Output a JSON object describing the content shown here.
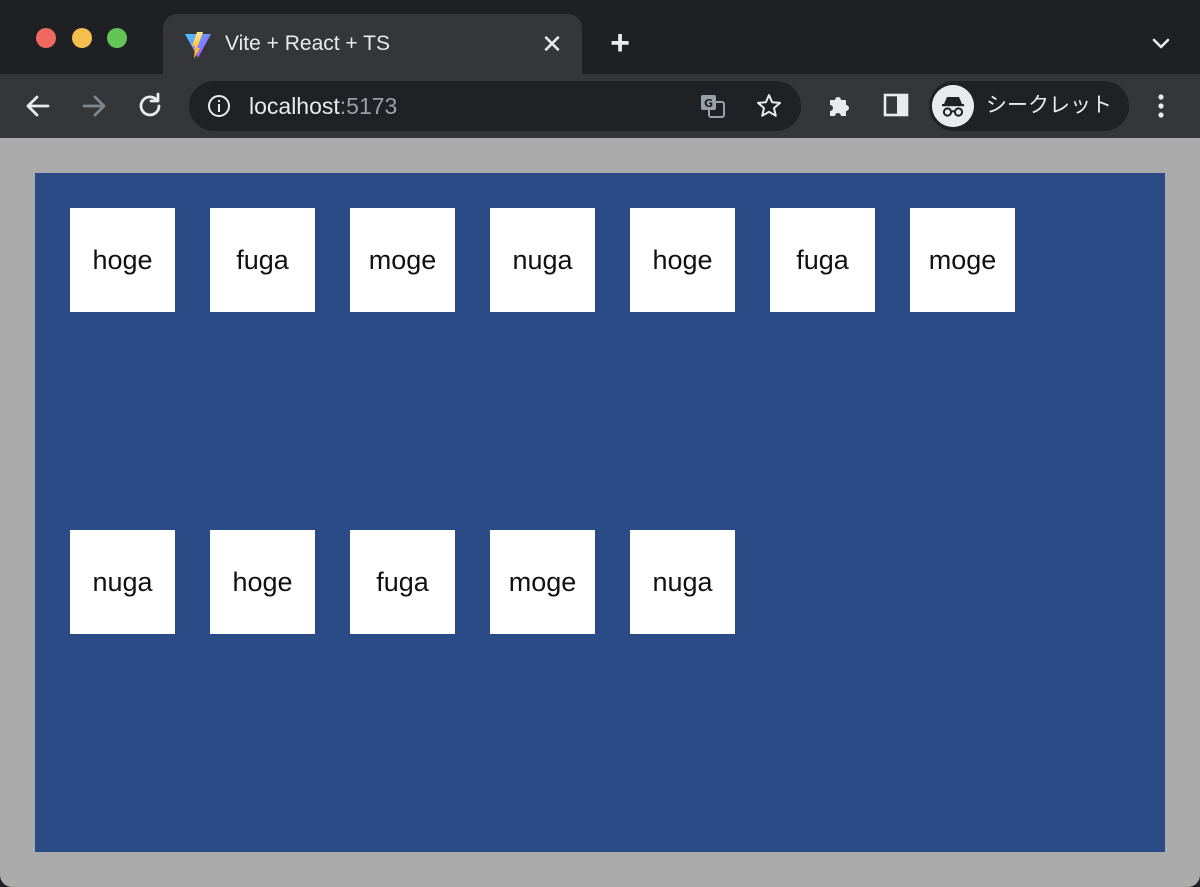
{
  "browser": {
    "tab": {
      "title": "Vite + React + TS"
    },
    "address": {
      "host": "localhost",
      "port": ":5173"
    },
    "profile": {
      "label": "シークレット"
    },
    "colors": {
      "frame": "#1f2023",
      "toolbar": "#35363a",
      "omnibox": "#202124"
    }
  },
  "page": {
    "background": "#aaaaaa",
    "container_color": "#2a4b85",
    "items": [
      {
        "label": "hoge"
      },
      {
        "label": "fuga"
      },
      {
        "label": "moge"
      },
      {
        "label": "nuga"
      },
      {
        "label": "hoge"
      },
      {
        "label": "fuga"
      },
      {
        "label": "moge"
      },
      {
        "label": "nuga"
      },
      {
        "label": "hoge"
      },
      {
        "label": "fuga"
      },
      {
        "label": "moge"
      },
      {
        "label": "nuga"
      }
    ]
  }
}
